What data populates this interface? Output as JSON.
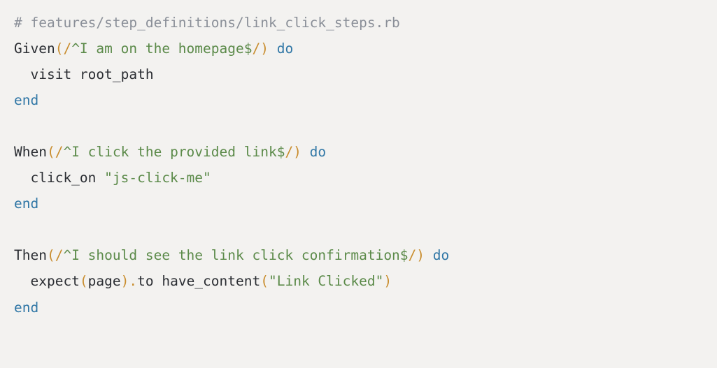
{
  "code": {
    "lines": [
      [
        {
          "cls": "c-comment",
          "text": "# features/step_definitions/link_click_steps.rb"
        }
      ],
      [
        {
          "cls": "c-text",
          "text": "Given"
        },
        {
          "cls": "c-keyword",
          "text": "(/"
        },
        {
          "cls": "c-string",
          "text": "^I am on the homepage$"
        },
        {
          "cls": "c-keyword",
          "text": "/)"
        },
        {
          "cls": "c-text",
          "text": " "
        },
        {
          "cls": "c-method",
          "text": "do"
        }
      ],
      [
        {
          "cls": "c-text",
          "text": "  visit root_path"
        }
      ],
      [
        {
          "cls": "c-method",
          "text": "end"
        }
      ],
      [
        {
          "cls": "c-text",
          "text": ""
        }
      ],
      [
        {
          "cls": "c-text",
          "text": "When"
        },
        {
          "cls": "c-keyword",
          "text": "(/"
        },
        {
          "cls": "c-string",
          "text": "^I click the provided link$"
        },
        {
          "cls": "c-keyword",
          "text": "/)"
        },
        {
          "cls": "c-text",
          "text": " "
        },
        {
          "cls": "c-method",
          "text": "do"
        }
      ],
      [
        {
          "cls": "c-text",
          "text": "  click_on "
        },
        {
          "cls": "c-string",
          "text": "\"js-click-me\""
        }
      ],
      [
        {
          "cls": "c-method",
          "text": "end"
        }
      ],
      [
        {
          "cls": "c-text",
          "text": ""
        }
      ],
      [
        {
          "cls": "c-text",
          "text": "Then"
        },
        {
          "cls": "c-keyword",
          "text": "(/"
        },
        {
          "cls": "c-string",
          "text": "^I should see the link click confirmation$"
        },
        {
          "cls": "c-keyword",
          "text": "/)"
        },
        {
          "cls": "c-text",
          "text": " "
        },
        {
          "cls": "c-method",
          "text": "do"
        }
      ],
      [
        {
          "cls": "c-text",
          "text": "  expect"
        },
        {
          "cls": "c-keyword",
          "text": "("
        },
        {
          "cls": "c-text",
          "text": "page"
        },
        {
          "cls": "c-keyword",
          "text": ")."
        },
        {
          "cls": "c-text",
          "text": "to have_content"
        },
        {
          "cls": "c-keyword",
          "text": "("
        },
        {
          "cls": "c-string",
          "text": "\"Link Clicked\""
        },
        {
          "cls": "c-keyword",
          "text": ")"
        }
      ],
      [
        {
          "cls": "c-method",
          "text": "end"
        }
      ]
    ]
  }
}
